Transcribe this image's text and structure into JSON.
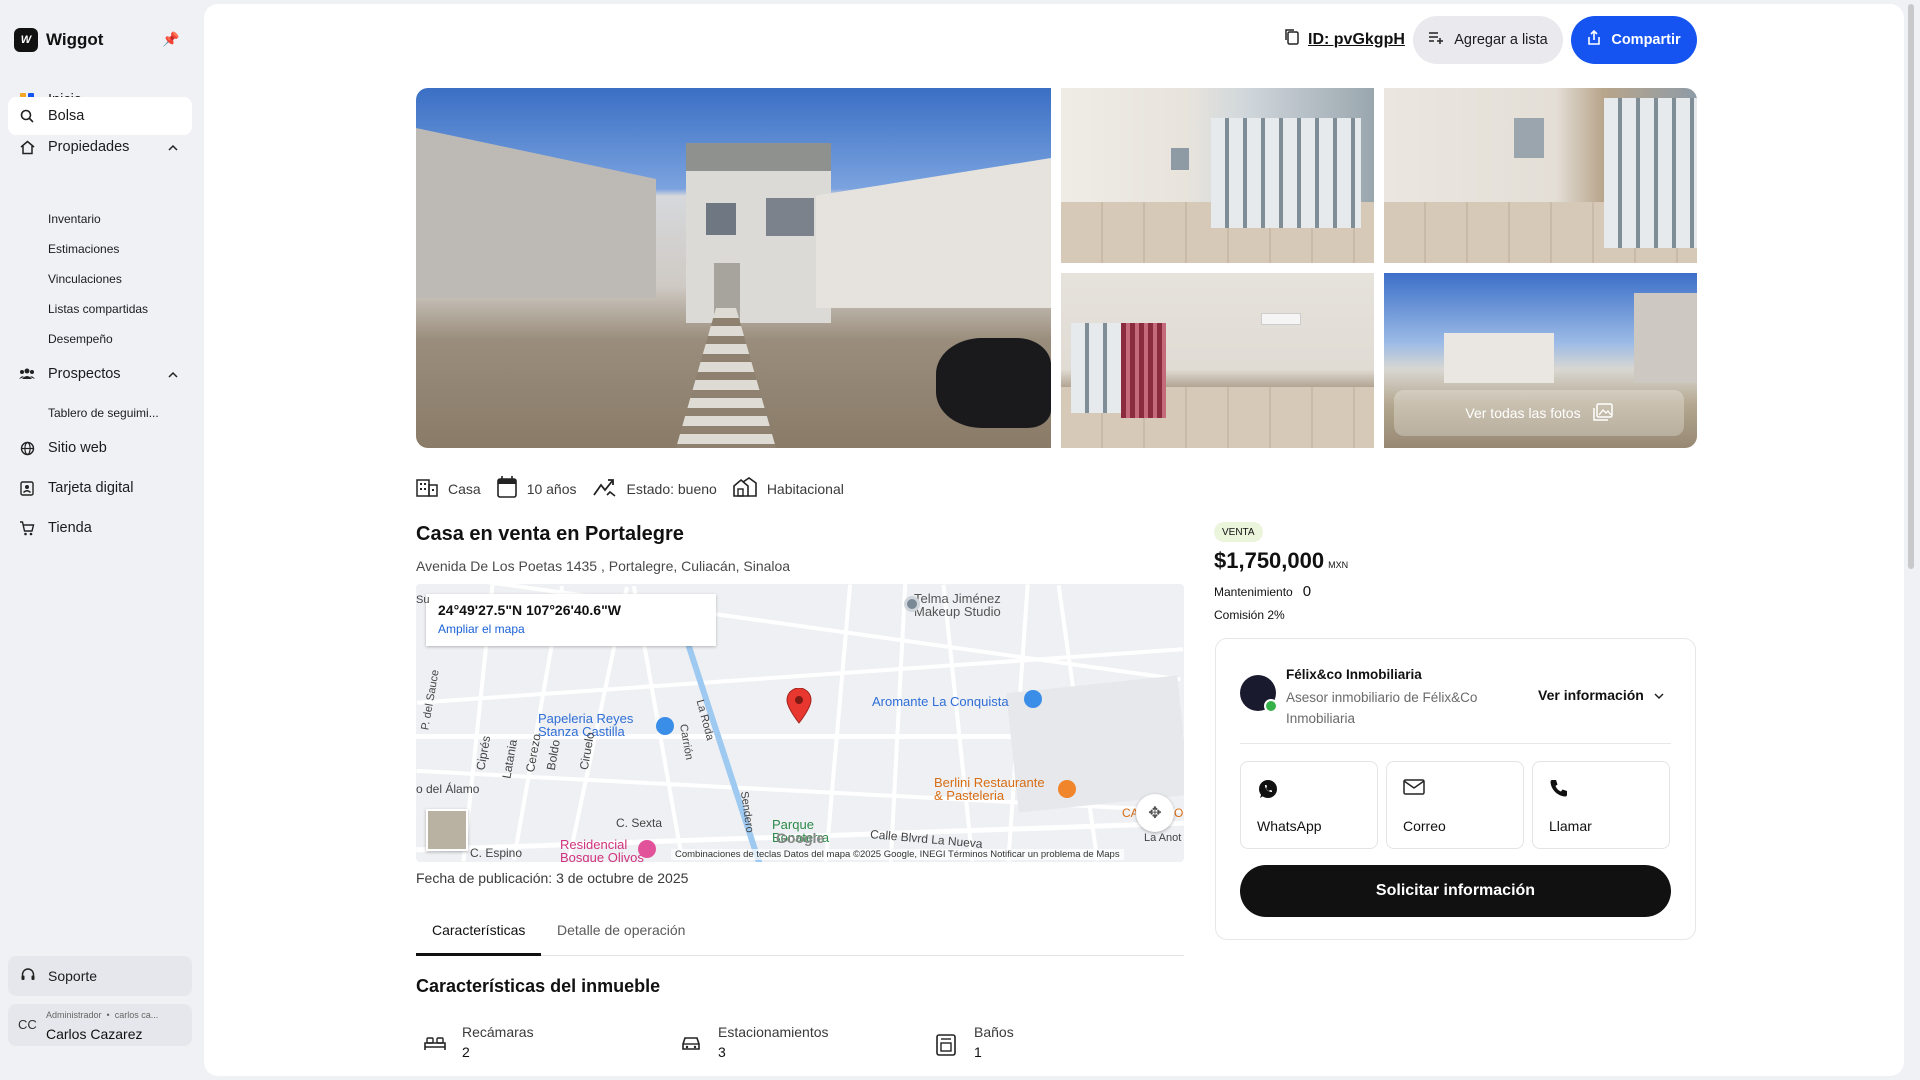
{
  "app": {
    "name": "Wiggot"
  },
  "sidebar": {
    "items": [
      {
        "label": "Inicio",
        "icon": "grid-icon"
      },
      {
        "label": "Bolsa",
        "icon": "search-icon"
      },
      {
        "label": "Propiedades",
        "icon": "house-icon"
      },
      {
        "label": "Prospectos",
        "icon": "people-icon"
      },
      {
        "label": "Sitio web",
        "icon": "globe-icon"
      },
      {
        "label": "Tarjeta digital",
        "icon": "id-card-icon"
      },
      {
        "label": "Tienda",
        "icon": "cart-icon"
      }
    ],
    "propiedades_sub": [
      "Inventario",
      "Estimaciones",
      "Vinculaciones",
      "Listas compartidas",
      "Desempeño"
    ],
    "prospectos_sub": [
      "Tablero de seguimi..."
    ],
    "support": "Soporte",
    "user": {
      "initials": "CC",
      "role": "Administrador",
      "email": "carlos ca...",
      "name": "Carlos Cazarez"
    }
  },
  "header": {
    "id_label": "ID: pvGkgpH",
    "add_to_list": "Agregar a lista",
    "share": "Compartir"
  },
  "gallery": {
    "view_all": "Ver todas las fotos"
  },
  "attributes": [
    {
      "label": "Casa",
      "icon": "building-icon"
    },
    {
      "label": "10 años",
      "icon": "calendar-icon"
    },
    {
      "label": "Estado: bueno",
      "icon": "trend-icon"
    },
    {
      "label": "Habitacional",
      "icon": "residential-icon"
    }
  ],
  "listing": {
    "title": "Casa en venta en Portalegre",
    "address": "Avenida De Los Poetas 1435 , Portalegre, Culiacán, Sinaloa",
    "publication_date": "Fecha de publicación: 3 de octubre de 2025"
  },
  "map": {
    "coords": "24°49'27.5\"N 107°26'40.6\"W",
    "expand": "Ampliar el mapa",
    "labels": {
      "telma": "Telma Jiménez\nMakeup Studio",
      "papeleria": "Papeleria Reyes\nStanza Castilla",
      "aromante": "Aromante La Conquista",
      "berlini": "Berlini Restaurante\n& Pasteleria",
      "residencial": "Residencial\nBosque Olivos",
      "parque": "Parque\nBonaterra",
      "cipres": "Ciprés",
      "latania": "Latania",
      "cerezo": "Cerezo",
      "boldo": "Boldo",
      "ciruelo": "Ciruelo",
      "alamo": "o del Álamo",
      "sexta": "C. Sexta",
      "espino": "C. Espino",
      "blvrd": "Calle Blvrd La Nueva",
      "laroda": "La Roda",
      "carrion": "Carrión",
      "sendero": "Sendero",
      "sauce": "P. del Sauce",
      "su": "Su",
      "ca": "CA",
      "o": "O",
      "la_anot": "La Anot"
    },
    "footer": "Combinaciones de teclas    Datos del mapa ©2025 Google, INEGI    Términos    Notificar un problema de Maps",
    "google": "Google"
  },
  "tabs": [
    "Características",
    "Detalle de operación"
  ],
  "features": {
    "title": "Características del inmueble",
    "items": [
      {
        "label": "Recámaras",
        "value": "2",
        "icon": "bed-icon"
      },
      {
        "label": "Estacionamientos",
        "value": "3",
        "icon": "car-icon"
      },
      {
        "label": "Baños",
        "value": "1",
        "icon": "bath-icon"
      }
    ]
  },
  "pricing": {
    "badge": "VENTA",
    "price": "$1,750,000",
    "currency": "MXN",
    "maintenance_label": "Mantenimiento",
    "maintenance_value": "0",
    "commission": "Comisión 2%"
  },
  "agent": {
    "name": "Félix&co Inmobiliaria",
    "description": "Asesor inmobiliario de Félix&Co Inmobiliaria",
    "more": "Ver información",
    "contacts": [
      "WhatsApp",
      "Correo",
      "Llamar"
    ],
    "request": "Solicitar información"
  },
  "colors": {
    "primary": "#1554f0",
    "dark": "#111111",
    "accent_green": "#35b24a"
  }
}
